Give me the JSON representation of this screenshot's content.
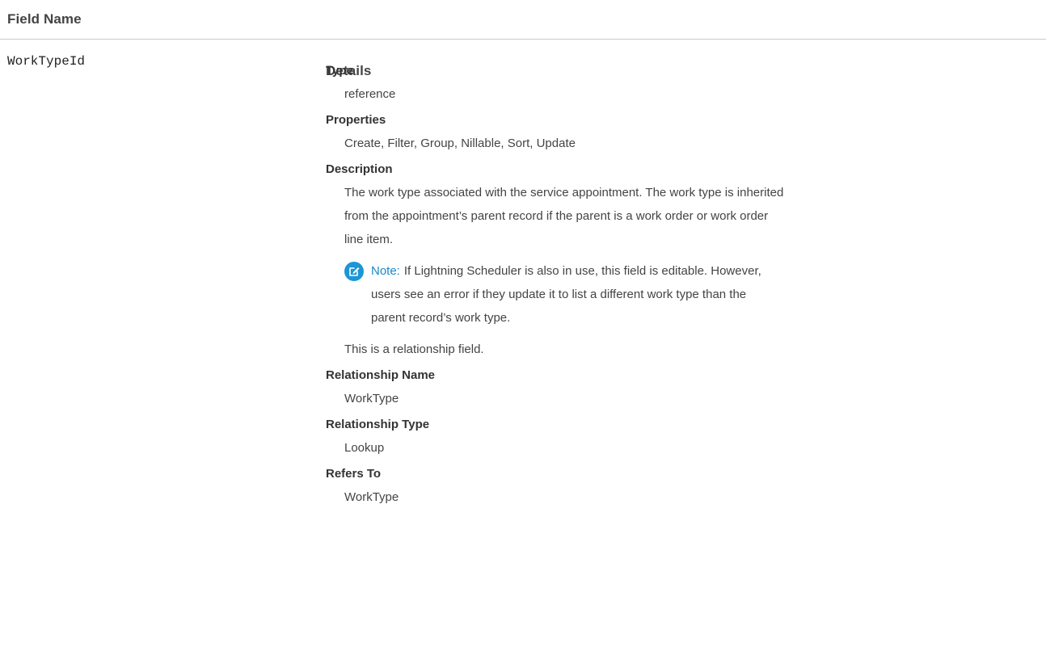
{
  "table": {
    "headers": {
      "field_name": "Field Name",
      "details": "Details"
    },
    "row": {
      "field_name": "WorkTypeId",
      "type_term": "Type",
      "type_value": "reference",
      "properties_term": "Properties",
      "properties_value": "Create, Filter, Group, Nillable, Sort, Update",
      "description_term": "Description",
      "description_line1": "The work type associated with the service appointment. The work type is inherited",
      "description_line2": "from the appointment’s parent record if the parent is a work order or work order",
      "description_line3": "line item.",
      "note_label": "Note:",
      "note_line1": "If Lightning Scheduler is also in use, this field is editable. However,",
      "note_line2": "users see an error if they update it to list a different work type than the",
      "note_line3": "parent record’s work type.",
      "relationship_field_text": "This is a relationship field.",
      "relationship_name_term": "Relationship Name",
      "relationship_name_value": "WorkType",
      "relationship_type_term": "Relationship Type",
      "relationship_type_value": "Lookup",
      "refers_to_term": "Refers To",
      "refers_to_value": "WorkType"
    }
  },
  "icons": {
    "note": "edit-note-icon"
  },
  "colors": {
    "note_accent": "#1b96d6",
    "header_rule": "#c9c9c9"
  }
}
